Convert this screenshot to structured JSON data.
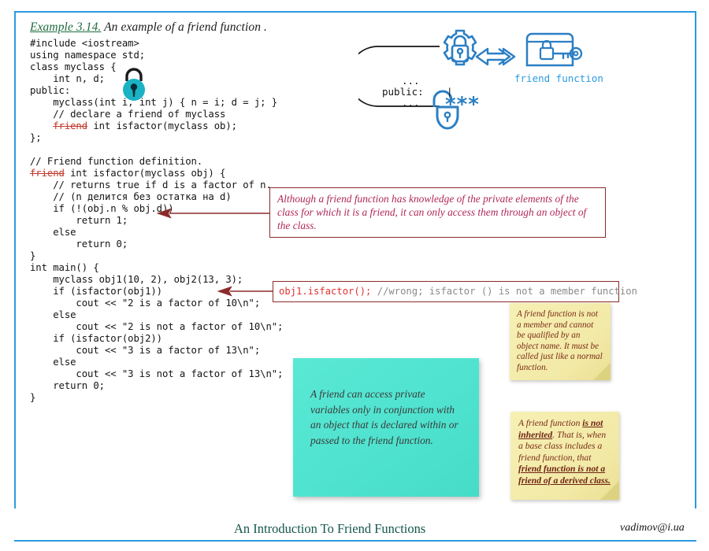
{
  "page": {
    "frame_color": "#2b9ae0",
    "background": "#ffffff"
  },
  "header": {
    "example_label": "Example 3.14.",
    "title_rest": " An example of a friend function ."
  },
  "code": {
    "language": "cpp",
    "lines": [
      "#include <iostream>",
      "using namespace std;",
      "class myclass {",
      "    int n, d;",
      "public:",
      "    myclass(int i, int j) { n = i; d = j; }",
      "    // declare a friend of myclass",
      "    friend int isfactor(myclass ob);",
      "};",
      "",
      "// Friend function definition.",
      "friend int isfactor(myclass obj) {",
      "    // returns true if d is a factor of n.",
      "    // (n делится без остатка на d)",
      "    if (!(obj.n % obj.d))",
      "        return 1;",
      "    else",
      "        return 0;",
      "}",
      "int main() {",
      "    myclass obj1(10, 2), obj2(13, 3);",
      "    if (isfactor(obj1))",
      "        cout << \"2 is a factor of 10\\n\";",
      "    else",
      "        cout << \"2 is not a factor of 10\\n\";",
      "    if (isfactor(obj2))",
      "        cout << \"3 is a factor of 13\\n\";",
      "    else",
      "        cout << \"3 is not a factor of 13\\n\";",
      "    return 0;",
      "}"
    ],
    "keyword_highlight": "friend",
    "keyword_color": "#2b9ae0",
    "strikethrough_keyword": "friend",
    "strikethrough_color": "#c0392b"
  },
  "diagram": {
    "dots_top": "...",
    "public_label": "public:",
    "dots_bottom": "...",
    "pipe": "|",
    "stars": "***",
    "friend_function_label": "friend function",
    "accent_color": "#2b7fc4",
    "icons": {
      "gear_lock": "gear-lock-icon",
      "arrow": "double-arrow-left-icon",
      "key_card": "key-card-icon",
      "open_lock": "open-padlock-icon"
    }
  },
  "callouts": {
    "note_private": "Although a friend function has knowledge of the private elements of the class for which it is a friend, it can only access them through an object of the class.",
    "code_snippet": "obj1.isfactor();",
    "code_comment": " //wrong; isfactor () is not a member function",
    "border_color": "#8c2a2a",
    "text_color": "#b0285a",
    "snippet_color": "#e03131",
    "comment_color": "#8a8a8a"
  },
  "notes": {
    "yellow_top": "A friend function is not a member and cannot be qualified by an object name. It must be called just like a normal function.",
    "yellow_bottom": {
      "part1": "A friend function ",
      "emph1": "is not inherited",
      "part2": ". That is, when a base class includes a friend function, that ",
      "emph2": "friend function is not a friend of a derived class."
    },
    "teal": "A friend can access private variables only in conjunction with an object that is declared within or passed to the friend function."
  },
  "footer": {
    "title": "An Introduction To Friend Functions",
    "email": "vadimov@i.ua",
    "title_color": "#14564b"
  }
}
